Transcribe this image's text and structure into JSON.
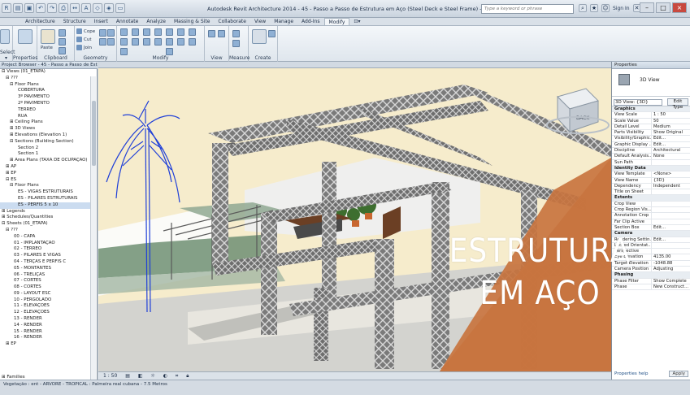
{
  "app": {
    "window_title": "Autodesk Revit Architecture 2014 - 45 - Passo a Passo de Estrutura em Aço (Steel Deck e Steel Frame) - 3D View: {3D}",
    "search_placeholder": "Type a keyword or phrase",
    "sign_in": "Sign In"
  },
  "ribbon_tabs": [
    "Architecture",
    "Structure",
    "Insert",
    "Annotate",
    "Analyze",
    "Massing & Site",
    "Collaborate",
    "View",
    "Manage",
    "Add-Ins",
    "Modify",
    "⊡▾"
  ],
  "ribbon_active_tab": "Modify",
  "ribbon": {
    "select_label": "Select ▾",
    "properties_label": "Properties",
    "clipboard_label": "Clipboard",
    "paste_label": "Paste",
    "cope_label": "Cope",
    "cut_label": "Cut",
    "join_label": "Join",
    "geometry_label": "Geometry",
    "modify_label": "Modify",
    "view_label": "View",
    "measure_label": "Measure",
    "create_label": "Create"
  },
  "project_browser": {
    "header": "Project Browser - 45 - Passo a Passo de Estrutura...",
    "rows": [
      {
        "text": "⊟ Views (01_ETAPA)",
        "indent": 0
      },
      {
        "text": "⊟ ???",
        "indent": 1
      },
      {
        "text": "⊟ Floor Plans",
        "indent": 2
      },
      {
        "text": "COBERTURA",
        "indent": 4
      },
      {
        "text": "3º PAVIMENTO",
        "indent": 4
      },
      {
        "text": "2º PAVIMENTO",
        "indent": 4
      },
      {
        "text": "TÉRREO",
        "indent": 4
      },
      {
        "text": "RUA",
        "indent": 4
      },
      {
        "text": "⊞ Ceiling Plans",
        "indent": 2
      },
      {
        "text": "⊞ 3D Views",
        "indent": 2
      },
      {
        "text": "⊞ Elevations (Elevation 1)",
        "indent": 2
      },
      {
        "text": "⊟ Sections (Building Section)",
        "indent": 2
      },
      {
        "text": "Section 2",
        "indent": 4
      },
      {
        "text": "Section 1",
        "indent": 4
      },
      {
        "text": "⊞ Area Plans (TAXA DE OCUPAÇÃO)",
        "indent": 2
      },
      {
        "text": "⊞ AP",
        "indent": 1
      },
      {
        "text": "⊞ EP",
        "indent": 1
      },
      {
        "text": "⊟ ES",
        "indent": 1
      },
      {
        "text": "⊟ Floor Plans",
        "indent": 2
      },
      {
        "text": "ES - VIGAS ESTRUTURAIS",
        "indent": 4
      },
      {
        "text": "ES - PILARES ESTRUTURAIS",
        "indent": 4
      },
      {
        "text": "ES - PERFIS 5 x 10",
        "indent": 4,
        "selected": true
      },
      {
        "text": "⊞ Legends",
        "indent": 0
      },
      {
        "text": "⊞ Schedules/Quantities",
        "indent": 0
      },
      {
        "text": "⊟ Sheets (01_ETAPA)",
        "indent": 0
      },
      {
        "text": "⊟ ???",
        "indent": 1
      },
      {
        "text": "00 - CAPA",
        "indent": 3
      },
      {
        "text": "01 - IMPLANTAÇÃO",
        "indent": 3
      },
      {
        "text": "02 - TÉRREO",
        "indent": 3
      },
      {
        "text": "03 - PILARES E VIGAS",
        "indent": 3
      },
      {
        "text": "04 - TERÇAS E PERFIS C",
        "indent": 3
      },
      {
        "text": "05 - MONTANTES",
        "indent": 3
      },
      {
        "text": "06 - TRELIÇAS",
        "indent": 3
      },
      {
        "text": "07 - CORTES",
        "indent": 3
      },
      {
        "text": "08 - CORTES",
        "indent": 3
      },
      {
        "text": "09 - LAYOUT ESC",
        "indent": 3
      },
      {
        "text": "10 - PERGOLADO",
        "indent": 3
      },
      {
        "text": "11 - ELEVAÇÕES",
        "indent": 3
      },
      {
        "text": "12 - ELEVAÇÕES",
        "indent": 3
      },
      {
        "text": "13 - RENDER",
        "indent": 3
      },
      {
        "text": "14 - RENDER",
        "indent": 3
      },
      {
        "text": "15 - RENDER",
        "indent": 3
      },
      {
        "text": "16 - RENDER",
        "indent": 3
      },
      {
        "text": "⊞ EP",
        "indent": 1
      }
    ],
    "families_label": "⊞ Families"
  },
  "viewport": {
    "scale_label": "1 : 50",
    "viewcube_label": "BACK"
  },
  "status_bar": {
    "text": "Vegetação : ent - ARVORE - TROPICAL : Palmeira real cubana - 7.5 Metros"
  },
  "properties": {
    "header": "Properties",
    "type_name": "3D View",
    "selector_value": "3D View: {3D}",
    "edit_type": "Edit Type",
    "rows": [
      {
        "section": "Graphics"
      },
      {
        "k": "View Scale",
        "v": "1 : 50"
      },
      {
        "k": "Scale Value",
        "v": "50"
      },
      {
        "k": "Detail Level",
        "v": "Medium"
      },
      {
        "k": "Parts Visibility",
        "v": "Show Original"
      },
      {
        "k": "Visibility/Graphic...",
        "v": "Edit..."
      },
      {
        "k": "Graphic Display ...",
        "v": "Edit..."
      },
      {
        "k": "Discipline",
        "v": "Architectural"
      },
      {
        "k": "Default Analysis...",
        "v": "None"
      },
      {
        "k": "Sun Path",
        "v": ""
      },
      {
        "section": "Identity Data"
      },
      {
        "k": "View Template",
        "v": "<None>"
      },
      {
        "k": "View Name",
        "v": "{3D}"
      },
      {
        "k": "Dependency",
        "v": "Independent"
      },
      {
        "k": "Title on Sheet",
        "v": ""
      },
      {
        "section": "Extents"
      },
      {
        "k": "Crop View",
        "v": ""
      },
      {
        "k": "Crop Region Vis...",
        "v": ""
      },
      {
        "k": "Annotation Crop",
        "v": ""
      },
      {
        "k": "Far Clip Active",
        "v": ""
      },
      {
        "k": "Section Box",
        "v": "Edit..."
      },
      {
        "section": "Camera"
      },
      {
        "k": "Rendering Settin...",
        "v": "Edit..."
      },
      {
        "k": "Locked Orientat...",
        "v": ""
      },
      {
        "k": "Perspective",
        "v": ""
      },
      {
        "k": "Eye Elevation",
        "v": "4135.00"
      },
      {
        "k": "Target Elevation",
        "v": "-1048.88"
      },
      {
        "k": "Camera Position",
        "v": "Adjusting"
      },
      {
        "section": "Phasing"
      },
      {
        "k": "Phase Filter",
        "v": "Show Complete"
      },
      {
        "k": "Phase",
        "v": "New Construct..."
      }
    ],
    "help_link": "Properties help",
    "apply": "Apply"
  },
  "overlay": {
    "line1": "ESTRUTURA",
    "line2": "EM AÇO"
  },
  "colors": {
    "overlay_orange": "#c8743f",
    "sky": "#f6eccc",
    "steel": "#6c6c6c"
  }
}
